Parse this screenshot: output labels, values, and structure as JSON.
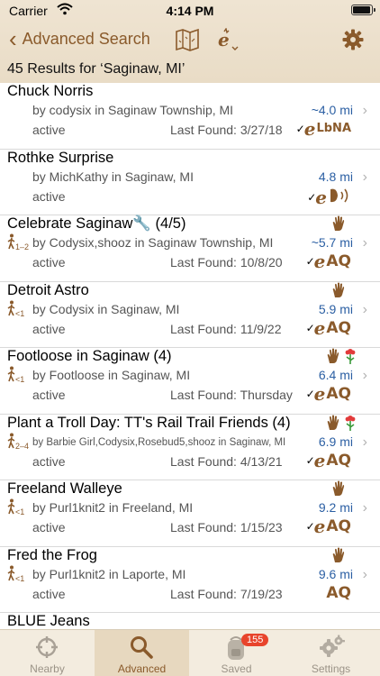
{
  "status_bar": {
    "carrier": "Carrier",
    "time": "4:14 PM"
  },
  "nav": {
    "back_label": "Advanced Search"
  },
  "results_header": "45 Results for ‘Saginaw, MI’",
  "results": [
    {
      "title": "Chuck Norris",
      "owner": "by codysix in Saginaw Township, MI",
      "status": "active",
      "last_found": "Last Found: 3/27/18",
      "distance": "~4.0 mi",
      "badge": "LbNA"
    },
    {
      "title": "Rothke Surprise",
      "owner": "by MichKathy in Saginaw, MI",
      "status": "active",
      "last_found": "",
      "distance": "4.8 mi",
      "badge": ""
    },
    {
      "title": "Celebrate Saginaw🔧 (4/5)",
      "owner": "by Codysix,shooz in Saginaw Township, MI",
      "status": "active",
      "last_found": "Last Found: 10/8/20",
      "distance": "~5.7 mi",
      "badge": "AQ",
      "hike": "1–2"
    },
    {
      "title": "Detroit Astro",
      "owner": "by Codysix in Saginaw, MI",
      "status": "active",
      "last_found": "Last Found: 11/9/22",
      "distance": "5.9 mi",
      "badge": "AQ",
      "hike": "<1"
    },
    {
      "title": "Footloose in Saginaw (4)",
      "owner": "by Footloose in Saginaw, MI",
      "status": "active",
      "last_found": "Last Found: Thursday",
      "distance": "6.4 mi",
      "badge": "AQ",
      "hike": "<1"
    },
    {
      "title": "Plant a Troll Day: TT's Rail Trail Friends (4)",
      "owner": "by Barbie Girl,Codysix,Rosebud5,shooz in Saginaw, MI",
      "status": "active",
      "last_found": "Last Found: 4/13/21",
      "distance": "6.9 mi",
      "badge": "AQ",
      "hike": "2–4"
    },
    {
      "title": "Freeland Walleye",
      "owner": "by Purl1knit2 in Freeland, MI",
      "status": "active",
      "last_found": "Last Found: 1/15/23",
      "distance": "9.2 mi",
      "badge": "AQ",
      "hike": "<1"
    },
    {
      "title": "Fred the Frog",
      "owner": "by Purl1knit2 in Laporte, MI",
      "status": "active",
      "last_found": "Last Found: 7/19/23",
      "distance": "9.6 mi",
      "badge": "AQ",
      "hike": "<1"
    },
    {
      "title": "BLUE Jeans"
    }
  ],
  "tabs": [
    {
      "label": "Nearby"
    },
    {
      "label": "Advanced"
    },
    {
      "label": "Saved",
      "count": "155"
    },
    {
      "label": "Settings"
    }
  ],
  "colors": {
    "accent": "#8a5a2b",
    "distance": "#2b5fa3",
    "badge_red": "#e8442c"
  }
}
